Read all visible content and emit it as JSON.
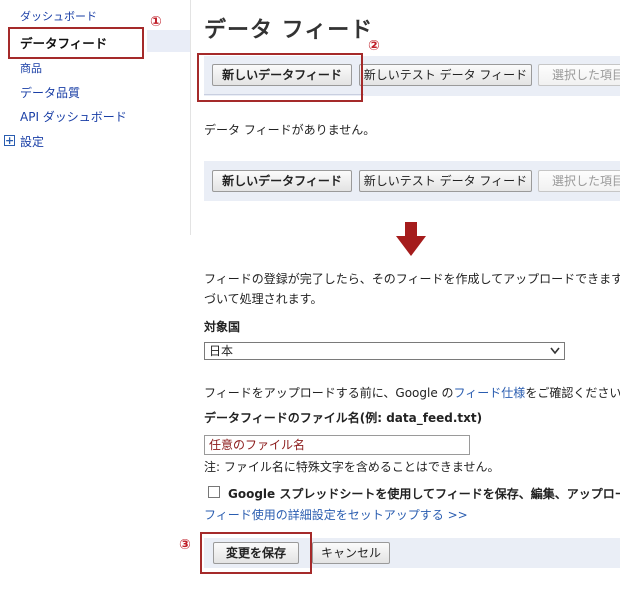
{
  "sidebar": {
    "items": [
      {
        "label": "ダッシュボード"
      },
      {
        "label": "データフィード"
      },
      {
        "label": "商品"
      },
      {
        "label": "データ品質"
      },
      {
        "label": "API ダッシュボード"
      },
      {
        "label": "設定"
      }
    ],
    "settings_expand_glyph": "+"
  },
  "page": {
    "title": "データ フィード",
    "empty_message": "データ フィードがありません。"
  },
  "toolbar": {
    "new_feed": "新しいデータフィード",
    "new_test_feed": "新しいテスト データ フィード",
    "selected_items": "選択した項目"
  },
  "form": {
    "info_text_line1": "フィードの登録が完了したら、そのフィードを作成してアップロードできます。フ",
    "info_text_line2": "づいて処理されます。",
    "target_country_label": "対象国",
    "target_country_value": "日本",
    "spec_prefix": "フィードをアップロードする前に、Google の",
    "spec_link": "フィード仕様",
    "spec_suffix": "をご確認ください。",
    "filename_label": "データフィードのファイル名(例: data_feed.txt)",
    "filename_value": "任意のファイル名",
    "filename_note": "注: ファイル名に特殊文字を含めることはできません。",
    "spreadsheet_label": "Google スプレッドシートを使用してフィードを保存、編集、アップロードす",
    "advanced_link": "フィード使用の詳細設定をセットアップする >>",
    "save": "変更を保存",
    "cancel": "キャンセル"
  },
  "annotations": {
    "marker1": "①",
    "marker2": "②",
    "marker3": "③",
    "annotation_color": "#a52a2a",
    "arrow_color": "#a51c1c"
  }
}
